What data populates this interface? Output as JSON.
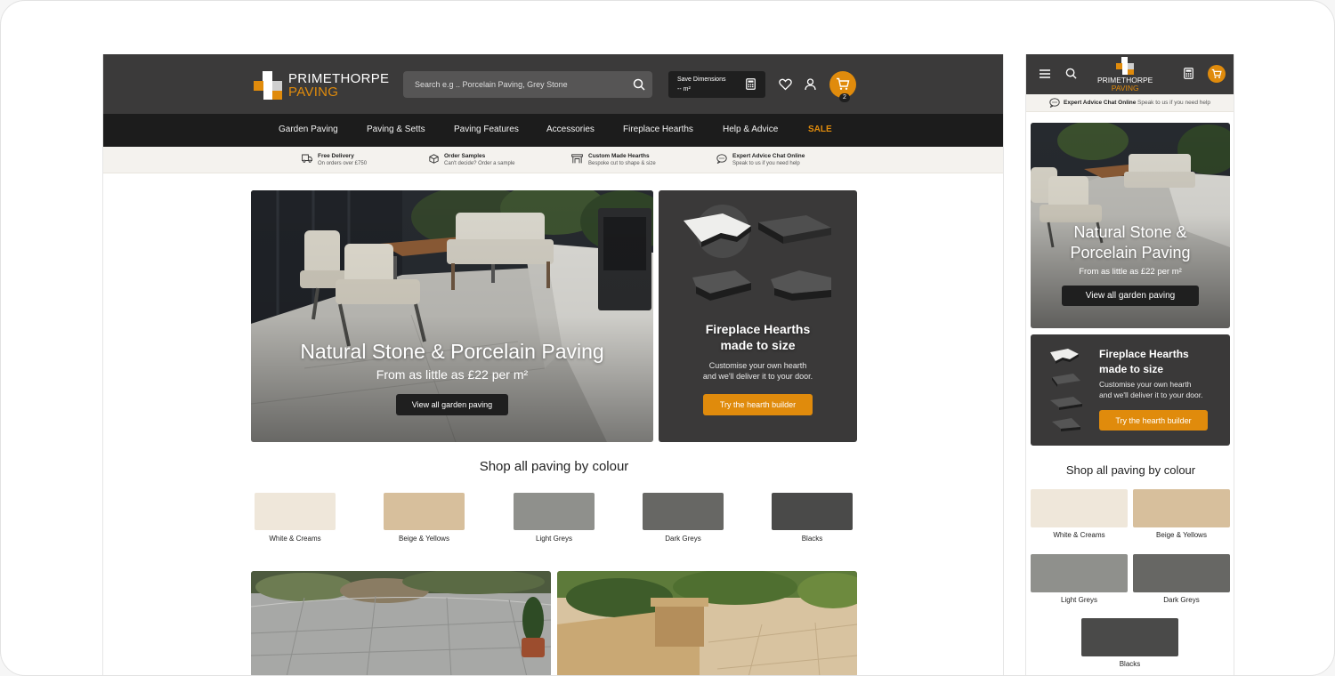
{
  "brand": {
    "line1": "PRIMETHORPE",
    "line2": "PAVING"
  },
  "search": {
    "placeholder": "Search e.g .. Porcelain Paving, Grey Stone"
  },
  "save_dimensions": {
    "title": "Save Dimensions",
    "value": "-- m²"
  },
  "cart": {
    "count": "2"
  },
  "nav": [
    {
      "label": "Garden Paving"
    },
    {
      "label": "Paving & Setts"
    },
    {
      "label": "Paving Features"
    },
    {
      "label": "Accessories"
    },
    {
      "label": "Fireplace Hearths"
    },
    {
      "label": "Help & Advice"
    },
    {
      "label": "SALE"
    }
  ],
  "usps": [
    {
      "title": "Free Delivery",
      "sub": "On orders over £750"
    },
    {
      "title": "Order Samples",
      "sub": "Can't decide? Order a sample"
    },
    {
      "title": "Custom Made Hearths",
      "sub": "Bespoke cut to shape & size"
    },
    {
      "title": "Expert Advice Chat Online",
      "sub": "Speak to us if you need help"
    }
  ],
  "hero": {
    "title": "Natural Stone & Porcelain Paving",
    "mobile_title_1": "Natural Stone &",
    "mobile_title_2": "Porcelain Paving",
    "subtitle": "From as little as £22 per m²",
    "button": "View all garden paving"
  },
  "hearth": {
    "title_1": "Fireplace Hearths",
    "title_2": "made to size",
    "text_1": "Customise your own hearth",
    "text_2": "and we'll deliver it to your door.",
    "button": "Try the hearth builder"
  },
  "colours": {
    "title": "Shop all paving by colour",
    "items": [
      {
        "label": "White & Creams",
        "color": "#efe7da"
      },
      {
        "label": "Beige & Yellows",
        "color": "#d7bf9c"
      },
      {
        "label": "Light Greys",
        "color": "#8f908c"
      },
      {
        "label": "Dark Greys",
        "color": "#676764"
      },
      {
        "label": "Blacks",
        "color": "#4a4a49"
      }
    ]
  },
  "mobile_chat": {
    "title": "Expert Advice Chat Online",
    "sub": "Speak to us if you need help"
  },
  "theme": {
    "accent": "#e08b0c",
    "header": "#3b3a3a",
    "nav": "#1c1c1c"
  }
}
